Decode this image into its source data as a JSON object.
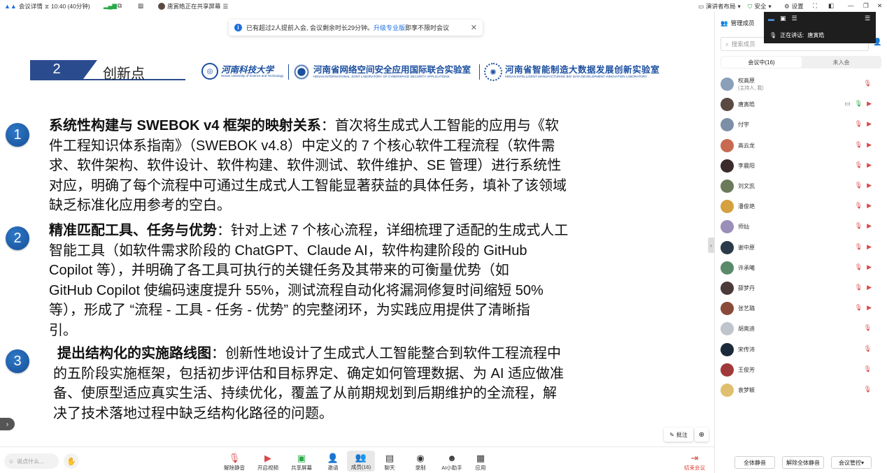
{
  "topbar": {
    "meeting_info": "会议详情",
    "timer": "10:40 (40分钟)",
    "sharing": "唐寅皓正在共享屏幕",
    "layout": "演讲者布局",
    "security": "安全",
    "settings": "设置"
  },
  "banner": {
    "text_before": "已有超过2人提前入会, 会议剩余时长29分钟。",
    "link": "升级专业版",
    "text_after": "即享不限时会议"
  },
  "slide": {
    "section_number": "2",
    "section_title": "创新点",
    "logos": [
      {
        "name": "河南科技大学",
        "subtitle": "Henan University of Science and Technology"
      },
      {
        "name": "河南省网络空间安全应用国际联合实验室",
        "subtitle": "HENAN INTERNATIONAL JOINT LABORATORY OF CYBERSPACE SECURITY APPLICATIONS"
      },
      {
        "name": "河南省智能制造大数据发展创新实验室",
        "subtitle": "HENAN INTELLIGENT MANUFACTURING BIG DATA DEVELOPMENT INNOVATION LABORATORY"
      }
    ],
    "points": [
      {
        "num": "1",
        "title": "系统性构建与 SWEBOK v4 框架的映射关系",
        "lines": [
          "：首次将生成式人工智能的应用与《软",
          "件工程知识体系指南》（SWEBOK v4.8）中定义的 7 个核心软件工程流程（软件需",
          "求、软件架构、软件设计、软件构建、软件测试、软件维护、SE 管理）进行系统性",
          "对应，明确了每个流程中可通过生成式人工智能显著获益的具体任务，填补了该领域",
          "缺乏标准化应用参考的空白。"
        ]
      },
      {
        "num": "2",
        "title": "精准匹配工具、任务与优势",
        "lines": [
          "：针对上述 7 个核心流程，详细梳理了适配的生成式人工",
          "智能工具（如软件需求阶段的 ChatGPT、Claude AI，软件构建阶段的 GitHub",
          "Copilot 等），并明确了各工具可执行的关键任务及其带来的可衡量优势（如",
          "GitHub Copilot 使编码速度提升 55%，测试流程自动化将漏洞修复时间缩短 50%",
          "等），形成了 “流程 - 工具 - 任务 - 优势” 的完整闭环，为实践应用提供了清晰指",
          "引。"
        ]
      },
      {
        "num": "3",
        "title": "提出结构化的实施路线图",
        "lines": [
          "：创新性地设计了生成式人工智能整合到软件工程流程中",
          "的五阶段实施框架，包括初步评估和目标界定、确定如何管理数据、为 AI 适应做准",
          "备、使原型适应真实生活、持续优化，覆盖了从前期规划到后期维护的全流程，解",
          "决了技术落地过程中缺乏结构化路径的问题。"
        ]
      }
    ]
  },
  "annotate_label": "批注",
  "toolbar": {
    "chat_placeholder": "说点什么...",
    "items": [
      {
        "label": "解除静音",
        "icon": "mic-muted-icon"
      },
      {
        "label": "开启视频",
        "icon": "camera-off-icon"
      },
      {
        "label": "共享屏幕",
        "icon": "share-screen-icon"
      },
      {
        "label": "邀请",
        "icon": "invite-icon"
      },
      {
        "label": "成员(16)",
        "icon": "members-icon"
      },
      {
        "label": "聊天",
        "icon": "chat-icon"
      },
      {
        "label": "录制",
        "icon": "record-icon"
      },
      {
        "label": "AI小助手",
        "icon": "ai-assistant-icon"
      },
      {
        "label": "应用",
        "icon": "apps-icon"
      }
    ],
    "end_label": "结束会议"
  },
  "recording": {
    "speaking_label": "正在讲话:",
    "speaker": "唐寅皓"
  },
  "panel": {
    "title": "管理成员",
    "search_placeholder": "搜索成员",
    "tab_in": "会议中(16)",
    "tab_out": "未入会",
    "members": [
      {
        "name": "权高原",
        "sub": "(主持人, 我)",
        "color": "#8aa0b8"
      },
      {
        "name": "唐寅皓",
        "sub": "",
        "color": "#5a4a42"
      },
      {
        "name": "付宇",
        "sub": "",
        "color": "#7c8fa6"
      },
      {
        "name": "高云龙",
        "sub": "",
        "color": "#c86a50"
      },
      {
        "name": "李晨阳",
        "sub": "",
        "color": "#3a2a2a"
      },
      {
        "name": "刘文凯",
        "sub": "",
        "color": "#6b7a5a"
      },
      {
        "name": "潘俊艳",
        "sub": "",
        "color": "#d4a040"
      },
      {
        "name": "师灿",
        "sub": "",
        "color": "#9a8fb8"
      },
      {
        "name": "谢中原",
        "sub": "",
        "color": "#2a3a4a"
      },
      {
        "name": "许承曦",
        "sub": "",
        "color": "#5a8a6a"
      },
      {
        "name": "薛梦丹",
        "sub": "",
        "color": "#4a3a3a"
      },
      {
        "name": "张艺璐",
        "sub": "",
        "color": "#8a4a3a"
      },
      {
        "name": "胡奥迪",
        "sub": "",
        "color": "#c0c4cc"
      },
      {
        "name": "宋传沛",
        "sub": "",
        "color": "#1a2a3a"
      },
      {
        "name": "王俊芳",
        "sub": "",
        "color": "#a03a3a"
      },
      {
        "name": "袁梦颖",
        "sub": "",
        "color": "#e0c070"
      }
    ],
    "mute_all": "全体静音",
    "unmute_all": "解除全体静音",
    "control": "会议管控"
  }
}
